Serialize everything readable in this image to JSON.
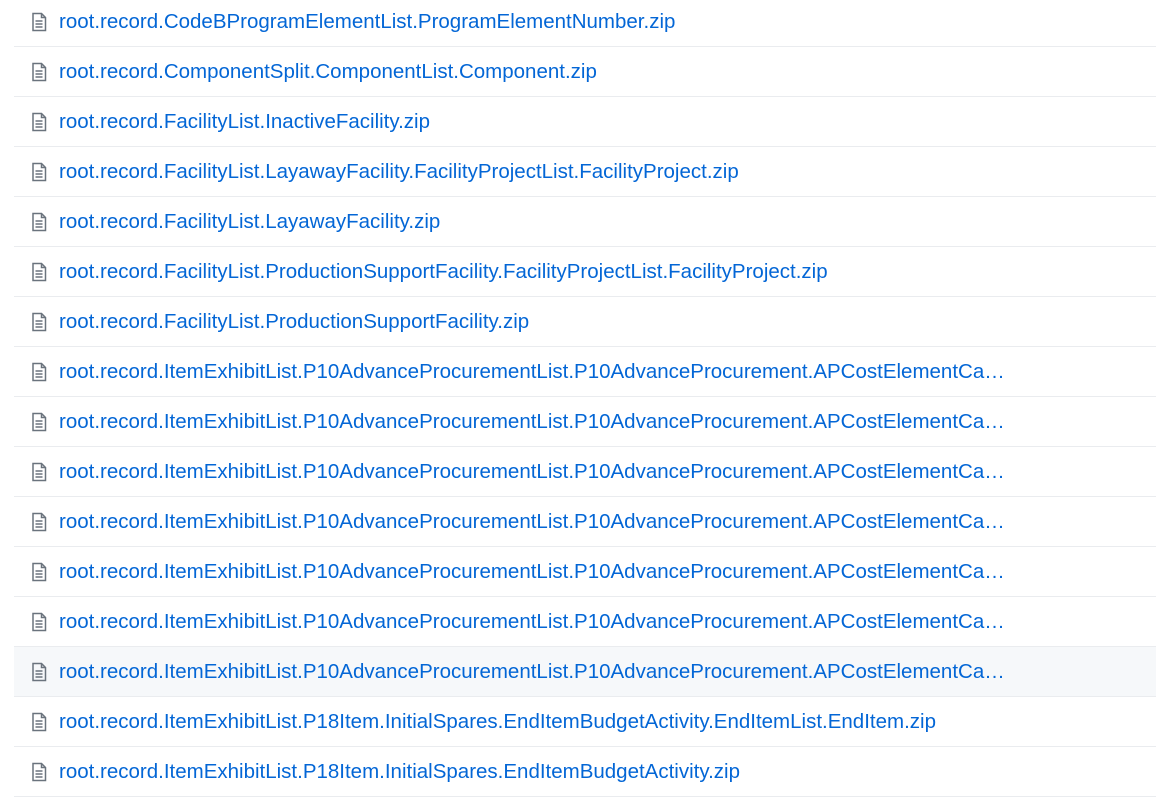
{
  "file_list": {
    "items": [
      {
        "icon": "file-icon",
        "name": "root.record.CodeBProgramElementList.ProgramElementNumber.zip"
      },
      {
        "icon": "file-icon",
        "name": "root.record.ComponentSplit.ComponentList.Component.zip"
      },
      {
        "icon": "file-icon",
        "name": "root.record.FacilityList.InactiveFacility.zip"
      },
      {
        "icon": "file-icon",
        "name": "root.record.FacilityList.LayawayFacility.FacilityProjectList.FacilityProject.zip"
      },
      {
        "icon": "file-icon",
        "name": "root.record.FacilityList.LayawayFacility.zip"
      },
      {
        "icon": "file-icon",
        "name": "root.record.FacilityList.ProductionSupportFacility.FacilityProjectList.FacilityProject.zip"
      },
      {
        "icon": "file-icon",
        "name": "root.record.FacilityList.ProductionSupportFacility.zip"
      },
      {
        "icon": "file-icon",
        "name": "root.record.ItemExhibitList.P10AdvanceProcurementList.P10AdvanceProcurement.APCostElementCa…"
      },
      {
        "icon": "file-icon",
        "name": "root.record.ItemExhibitList.P10AdvanceProcurementList.P10AdvanceProcurement.APCostElementCa…"
      },
      {
        "icon": "file-icon",
        "name": "root.record.ItemExhibitList.P10AdvanceProcurementList.P10AdvanceProcurement.APCostElementCa…"
      },
      {
        "icon": "file-icon",
        "name": "root.record.ItemExhibitList.P10AdvanceProcurementList.P10AdvanceProcurement.APCostElementCa…"
      },
      {
        "icon": "file-icon",
        "name": "root.record.ItemExhibitList.P10AdvanceProcurementList.P10AdvanceProcurement.APCostElementCa…"
      },
      {
        "icon": "file-icon",
        "name": "root.record.ItemExhibitList.P10AdvanceProcurementList.P10AdvanceProcurement.APCostElementCa…"
      },
      {
        "icon": "file-icon",
        "name": "root.record.ItemExhibitList.P10AdvanceProcurementList.P10AdvanceProcurement.APCostElementCa…",
        "highlighted": true
      },
      {
        "icon": "file-icon",
        "name": "root.record.ItemExhibitList.P18Item.InitialSpares.EndItemBudgetActivity.EndItemList.EndItem.zip"
      },
      {
        "icon": "file-icon",
        "name": "root.record.ItemExhibitList.P18Item.InitialSpares.EndItemBudgetActivity.zip"
      }
    ]
  },
  "colors": {
    "link": "#0366d6",
    "icon": "#6a737d",
    "row_border": "#eaecef",
    "row_highlight": "#f6f8fa"
  }
}
